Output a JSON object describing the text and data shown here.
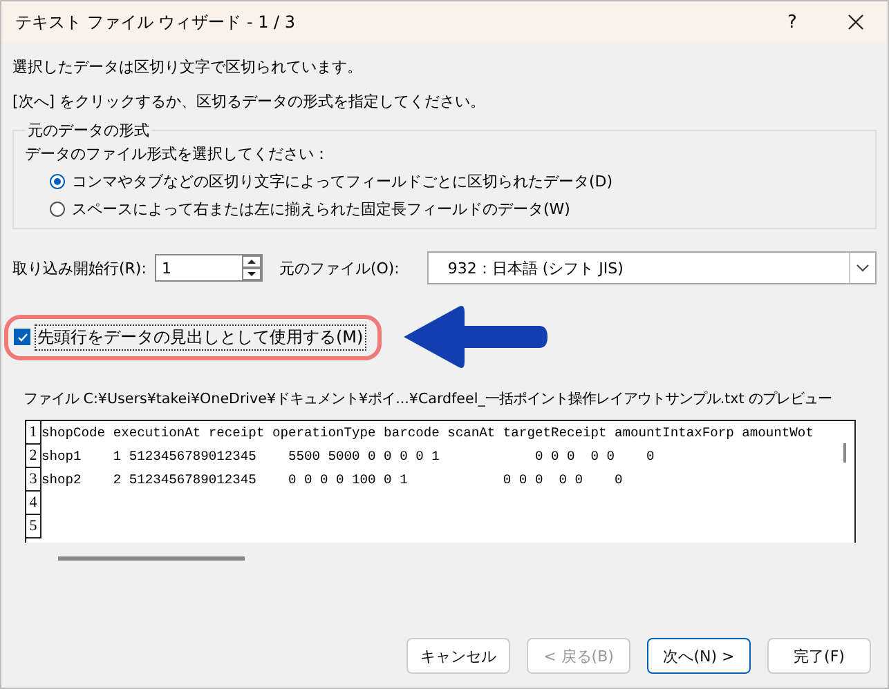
{
  "window": {
    "title": "テキスト ファイル ウィザード - 1 / 3",
    "help": "?"
  },
  "intro": [
    "選択したデータは区切り文字で区切られています。",
    "[次へ] をクリックするか、区切るデータの形式を指定してください。"
  ],
  "format_group": {
    "title": "元のデータの形式",
    "prompt": "データのファイル形式を選択してください：",
    "options": [
      {
        "label": "コンマやタブなどの区切り文字によってフィールドごとに区切られたデータ(D)",
        "selected": true
      },
      {
        "label": "スペースによって右または左に揃えられた固定長フィールドのデータ(W)",
        "selected": false
      }
    ]
  },
  "start_row": {
    "label": "取り込み開始行(R):",
    "value": "1"
  },
  "origin": {
    "label": "元のファイル(O):",
    "value": "932：日本語 (シフト JIS)"
  },
  "header_checkbox": {
    "label": "先頭行をデータの見出しとして使用する(M)",
    "checked": true
  },
  "preview": {
    "title": "ファイル C:¥Users¥takei¥OneDrive¥ドキュメント¥ポイ...¥Cardfeel_一括ポイント操作レイアウトサンプル.txt のプレビュー",
    "rows": [
      {
        "number": "1",
        "text": "shopCode executionAt receipt operationType barcode scanAt targetReceipt amountIntaxForp amountWot"
      },
      {
        "number": "2",
        "text": "shop1    1 5123456789012345    5500 5000 0 0 0 0 1            0 0 0  0 0    0"
      },
      {
        "number": "3",
        "text": "shop2    2 5123456789012345    0 0 0 0 100 0 1            0 0 0  0 0    0"
      },
      {
        "number": "4",
        "text": ""
      },
      {
        "number": "5",
        "text": ""
      }
    ]
  },
  "buttons": [
    {
      "label": "キャンセル",
      "disabled": false,
      "default": false
    },
    {
      "label": "< 戻る(B)",
      "disabled": true,
      "default": false
    },
    {
      "label": "次へ(N) >",
      "disabled": false,
      "default": true
    },
    {
      "label": "完了(F)",
      "disabled": false,
      "default": false
    }
  ]
}
